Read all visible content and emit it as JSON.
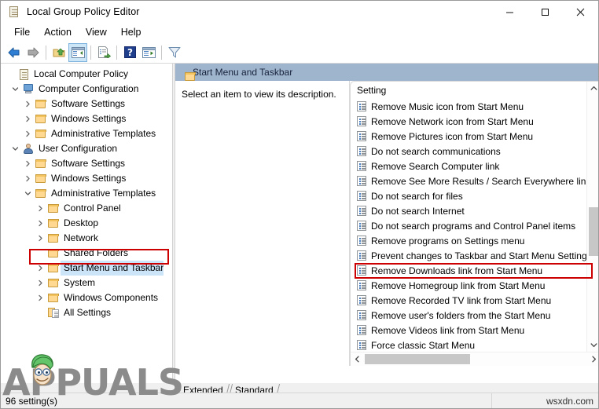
{
  "window": {
    "title": "Local Group Policy Editor",
    "icon": "policy-document-icon",
    "minimize_label": "Minimize",
    "maximize_label": "Maximize",
    "close_label": "Close"
  },
  "menubar": {
    "items": [
      {
        "label": "File"
      },
      {
        "label": "Action"
      },
      {
        "label": "View"
      },
      {
        "label": "Help"
      }
    ]
  },
  "toolbar": {
    "buttons": [
      {
        "name": "back-arrow-icon",
        "label": "Back"
      },
      {
        "name": "forward-arrow-icon",
        "label": "Forward"
      },
      {
        "name": "up-one-level-icon",
        "label": "Up One Level"
      },
      {
        "name": "show-hide-console-tree-icon",
        "label": "Show/Hide Console Tree",
        "active": true
      },
      {
        "name": "export-list-icon",
        "label": "Export List"
      },
      {
        "name": "help-icon",
        "label": "Help"
      },
      {
        "name": "properties-icon",
        "label": "Properties"
      },
      {
        "name": "filter-icon",
        "label": "Filter"
      }
    ]
  },
  "tree": {
    "items": [
      {
        "label": "Local Computer Policy",
        "indent": 0,
        "twisty": "none",
        "icon": "policy-scroll-icon"
      },
      {
        "label": "Computer Configuration",
        "indent": 1,
        "twisty": "expanded",
        "icon": "computer-icon"
      },
      {
        "label": "Software Settings",
        "indent": 2,
        "twisty": "collapsed",
        "icon": "folder-icon"
      },
      {
        "label": "Windows Settings",
        "indent": 2,
        "twisty": "collapsed",
        "icon": "folder-icon"
      },
      {
        "label": "Administrative Templates",
        "indent": 2,
        "twisty": "collapsed",
        "icon": "folder-icon"
      },
      {
        "label": "User Configuration",
        "indent": 1,
        "twisty": "expanded",
        "icon": "user-icon"
      },
      {
        "label": "Software Settings",
        "indent": 2,
        "twisty": "collapsed",
        "icon": "folder-icon"
      },
      {
        "label": "Windows Settings",
        "indent": 2,
        "twisty": "collapsed",
        "icon": "folder-icon"
      },
      {
        "label": "Administrative Templates",
        "indent": 2,
        "twisty": "expanded",
        "icon": "folder-icon"
      },
      {
        "label": "Control Panel",
        "indent": 3,
        "twisty": "collapsed",
        "icon": "folder-icon"
      },
      {
        "label": "Desktop",
        "indent": 3,
        "twisty": "collapsed",
        "icon": "folder-icon"
      },
      {
        "label": "Network",
        "indent": 3,
        "twisty": "collapsed",
        "icon": "folder-icon"
      },
      {
        "label": "Shared Folders",
        "indent": 3,
        "twisty": "none",
        "icon": "folder-icon"
      },
      {
        "label": "Start Menu and Taskbar",
        "indent": 3,
        "twisty": "collapsed",
        "icon": "folder-icon",
        "selected": true,
        "highlighted": true
      },
      {
        "label": "System",
        "indent": 3,
        "twisty": "collapsed",
        "icon": "folder-icon"
      },
      {
        "label": "Windows Components",
        "indent": 3,
        "twisty": "collapsed",
        "icon": "folder-icon"
      },
      {
        "label": "All Settings",
        "indent": 3,
        "twisty": "none",
        "icon": "all-settings-icon"
      }
    ]
  },
  "right_pane": {
    "header_title": "Start Menu and Taskbar",
    "header_icon": "folder-icon",
    "header_color": "#9fb5cd",
    "description": "Select an item to view its description.",
    "column_header": "Setting",
    "settings": [
      {
        "label": "Remove Music icon from Start Menu"
      },
      {
        "label": "Remove Network icon from Start Menu"
      },
      {
        "label": "Remove Pictures icon from Start Menu"
      },
      {
        "label": "Do not search communications"
      },
      {
        "label": "Remove Search Computer link"
      },
      {
        "label": "Remove See More Results / Search Everywhere link"
      },
      {
        "label": "Do not search for files"
      },
      {
        "label": "Do not search Internet"
      },
      {
        "label": "Do not search programs and Control Panel items"
      },
      {
        "label": "Remove programs on Settings menu"
      },
      {
        "label": "Prevent changes to Taskbar and Start Menu Settings",
        "highlighted": true
      },
      {
        "label": "Remove Downloads link from Start Menu"
      },
      {
        "label": "Remove Homegroup link from Start Menu"
      },
      {
        "label": "Remove Recorded TV link from Start Menu"
      },
      {
        "label": "Remove user's folders from the Start Menu"
      },
      {
        "label": "Remove Videos link from Start Menu"
      },
      {
        "label": "Force classic Start Menu"
      }
    ]
  },
  "tabs": [
    {
      "label": "Extended",
      "active": false
    },
    {
      "label": "Standard",
      "active": true
    }
  ],
  "statusbar": {
    "text": "96 setting(s)",
    "right_text": "wsxdn.com"
  },
  "watermark": {
    "text": "APPUALS"
  },
  "colors": {
    "highlight_red": "#cc0000",
    "selection_blue": "#cce4f7",
    "header_blue": "#9fb5cd"
  }
}
